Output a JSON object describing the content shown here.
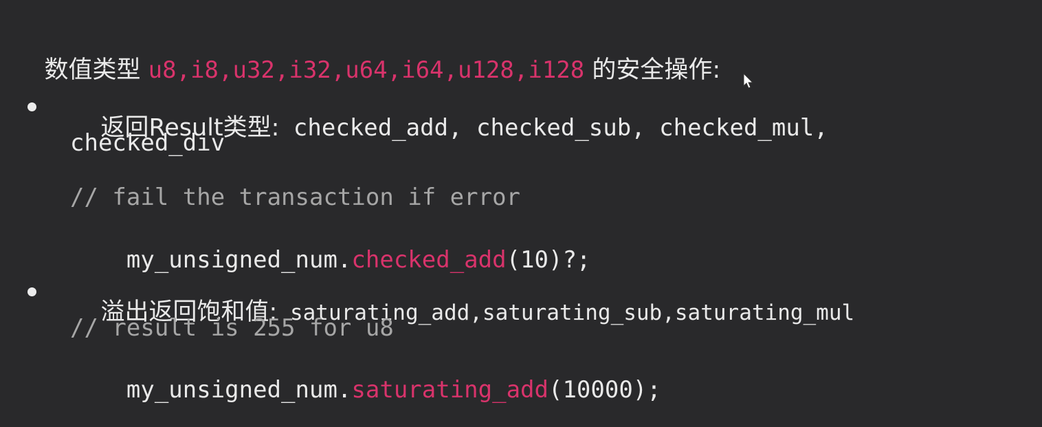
{
  "heading": {
    "prefix": "数值类型 ",
    "types": "u8,i8,u32,i32,u64,i64,u128,i128",
    "suffix": " 的安全操作:"
  },
  "bullet1": {
    "label": "返回Result类型:",
    "methods_line1": " checked_add, checked_sub, checked_mul,",
    "methods_line2": "checked_div",
    "code_comment": "// fail the transaction if error",
    "code_object": "my_unsigned_num.",
    "code_method": "checked_add",
    "code_args": "(10)?;"
  },
  "bullet2": {
    "label": "溢出返回饱和值:",
    "methods": " saturating_add,saturating_sub,saturating_mul",
    "code_comment": "// result is 255 for u8",
    "code_object": "my_unsigned_num.",
    "code_method": "saturating_add",
    "code_args": "(10000);"
  },
  "colors": {
    "background": "#29292b",
    "text": "#e9e9e9",
    "accent": "#d8336b",
    "comment": "#a6a6a6"
  },
  "icons": [
    "mouse-cursor-icon",
    "bullet-icon"
  ]
}
